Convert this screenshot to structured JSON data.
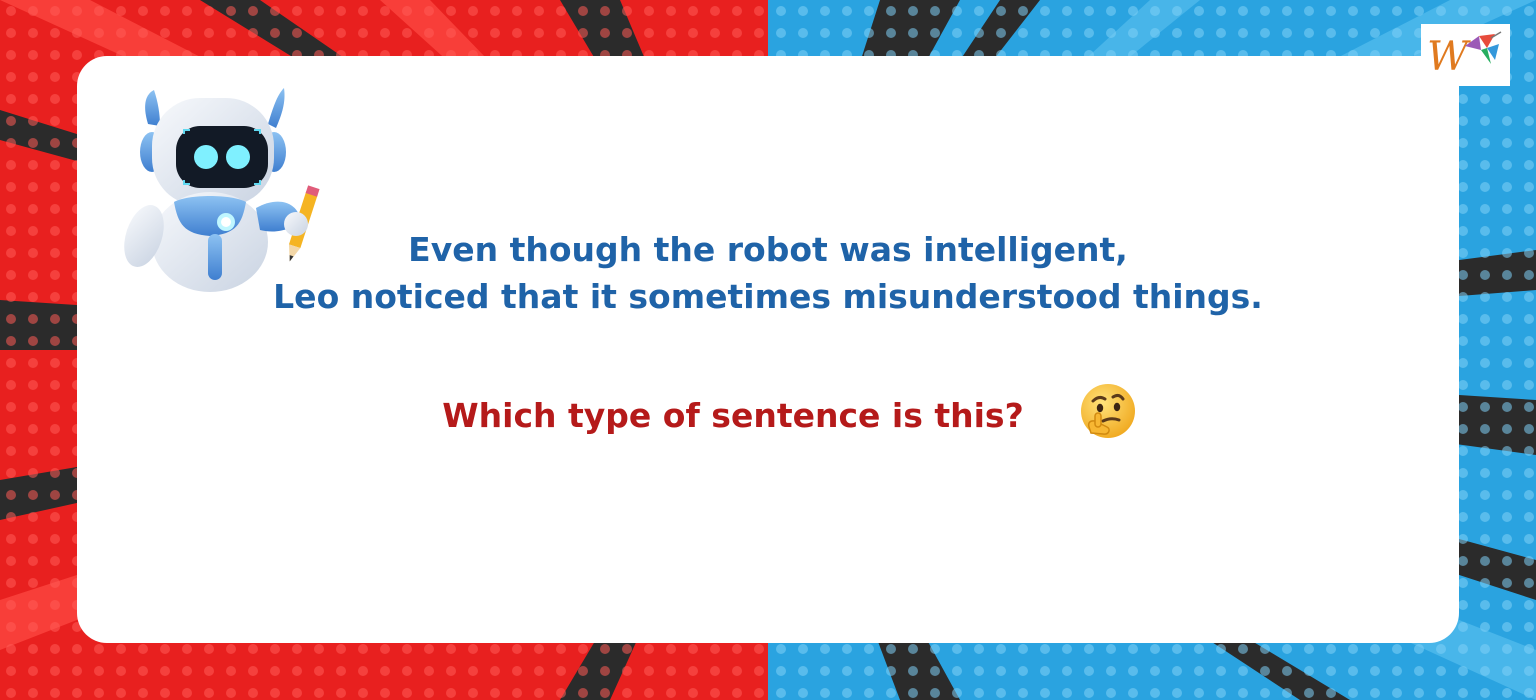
{
  "slide": {
    "statement_line1": "Even though the robot was intelligent,",
    "statement_line2": "Leo noticed that it sometimes misunderstood things.",
    "question": "Which type of sentence is this?"
  },
  "icons": {
    "robot": "robot-with-pencil-icon",
    "thinking": "thinking-face-icon",
    "logo": "w-logo-icon"
  },
  "colors": {
    "statement_text": "#1f63a8",
    "question_text": "#b51a1a",
    "left_burst": "#e8201f",
    "right_burst": "#2aa3e0"
  }
}
